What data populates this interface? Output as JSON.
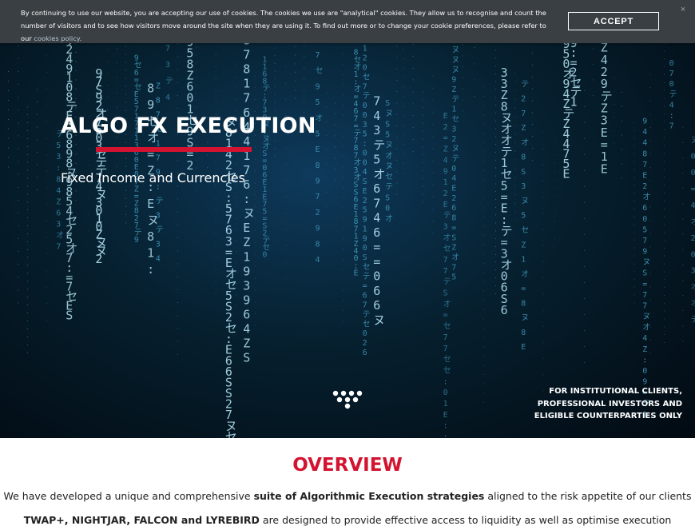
{
  "cookie_banner": {
    "text": "By continuing to use our website, you are accepting our use of cookies. The cookies we use are \"analytical\" cookies. They allow us to recognise and count the number of visitors and to see how visitors move around the site when they are using it. To find out more or to change your cookie preferences, please refer to our",
    "link_text": "cookies policy.",
    "accept_label": "ACCEPT",
    "close_glyph": "×"
  },
  "hero": {
    "title": "ALGO FX EXECUTION",
    "subtitle": "Fixed Income and Currencies",
    "disclaimer": [
      "FOR INSTITUTIONAL CLIENTS,",
      "PROFESSIONAL INVESTORS AND",
      "ELIGIBLE COUNTERPARTIES ONLY"
    ],
    "accent_color": "#d3132f"
  },
  "overview": {
    "title": "OVERVIEW",
    "line1_before": "We have developed a unique and comprehensive",
    "line1_bold": "suite of Algorithmic Execution strategies",
    "line1_after": "aligned to the risk appetite of our clients",
    "line2_bold": "TWAP+, NIGHTJAR, FALCON and LYREBIRD",
    "line2_after": "are designed to provide effective access to liquidity as well as optimise execution"
  }
}
